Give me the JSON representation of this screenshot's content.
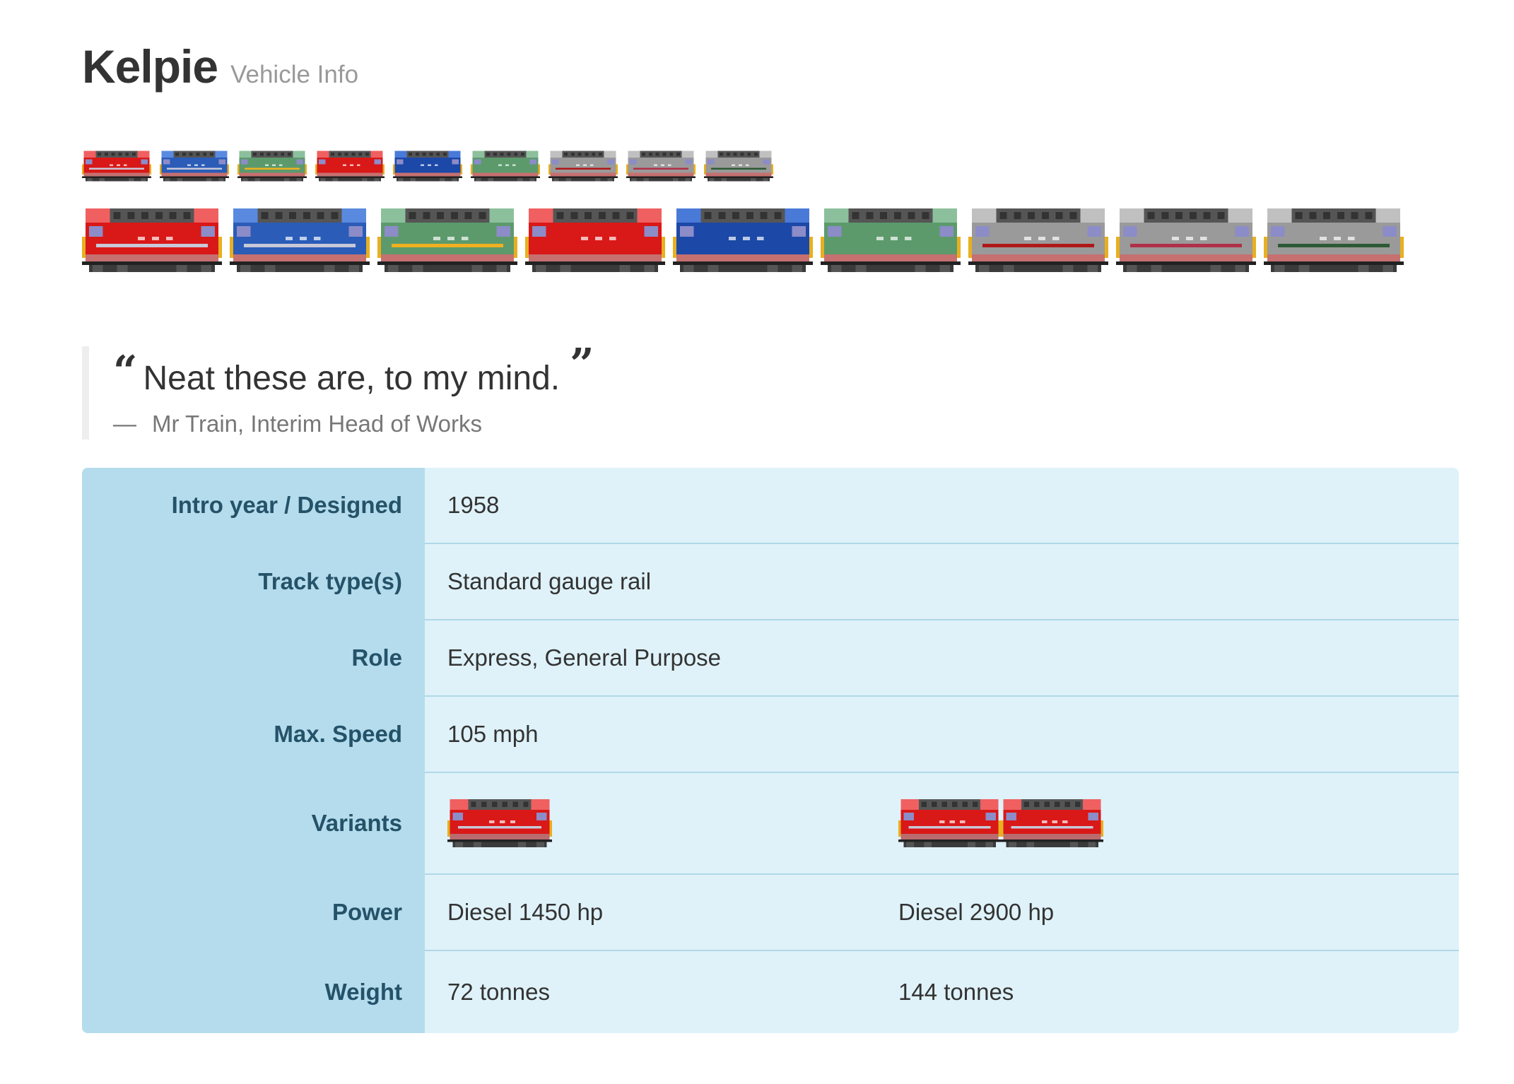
{
  "header": {
    "title": "Kelpie",
    "subtitle": "Vehicle Info"
  },
  "liveries": [
    {
      "body": "#d91818",
      "cab": "#f06060",
      "stripe": "#c8c8d8",
      "trim": "#e8b020"
    },
    {
      "body": "#2a5cb8",
      "cab": "#5a8ae0",
      "stripe": "#c8c8d8",
      "trim": "#e8b020"
    },
    {
      "body": "#5c9a6c",
      "cab": "#8cc09c",
      "stripe": "#f0b020",
      "trim": "#e8b020"
    },
    {
      "body": "#d91818",
      "cab": "#f06060",
      "stripe": "#d91818",
      "trim": "#e8b020"
    },
    {
      "body": "#1c48a8",
      "cab": "#4a7ad8",
      "stripe": "#1c48a8",
      "trim": "#e8b020"
    },
    {
      "body": "#5c9a6c",
      "cab": "#8cc09c",
      "stripe": "#5c9a6c",
      "trim": "#e8b020"
    },
    {
      "body": "#9a9a9a",
      "cab": "#c0c0c0",
      "stripe": "#b01818",
      "trim": "#e8b020"
    },
    {
      "body": "#9a9a9a",
      "cab": "#c0c0c0",
      "stripe": "#b03048",
      "trim": "#e8b020"
    },
    {
      "body": "#9a9a9a",
      "cab": "#c0c0c0",
      "stripe": "#2c5a34",
      "trim": "#e8b020"
    }
  ],
  "quote": {
    "text": "Neat these are, to my mind.",
    "open_mark": "“",
    "close_mark": "”",
    "dash": "—",
    "citation": "Mr Train, Interim Head of Works"
  },
  "table": {
    "intro_label": "Intro year / Designed",
    "intro_value": "1958",
    "track_label": "Track type(s)",
    "track_value": "Standard gauge rail",
    "role_label": "Role",
    "role_value": "Express, General Purpose",
    "speed_label": "Max. Speed",
    "speed_value": "105 mph",
    "variants_label": "Variants",
    "power_label": "Power",
    "power_single": "Diesel 1450 hp",
    "power_double": "Diesel 2900 hp",
    "weight_label": "Weight",
    "weight_single": "72 tonnes",
    "weight_double": "144 tonnes"
  }
}
